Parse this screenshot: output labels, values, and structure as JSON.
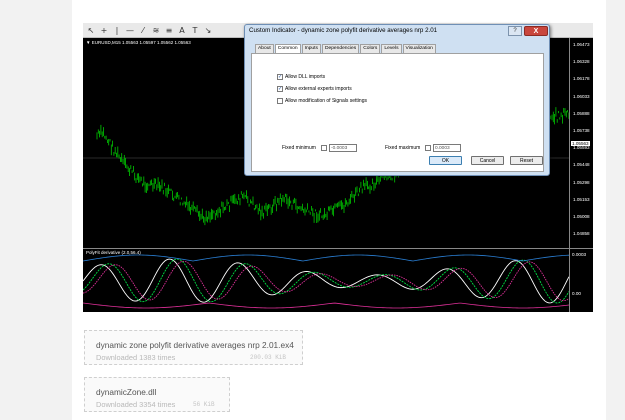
{
  "toolbar": {
    "icons": [
      "cursor-icon",
      "crosshair-icon",
      "vertical-line-icon",
      "horizontal-line-icon",
      "trendline-icon",
      "fibonacci-icon",
      "channel-icon",
      "text-icon",
      "text-label-icon",
      "arrows-icon"
    ],
    "glyphs": [
      "↖",
      "+",
      "|",
      "—",
      "⁄",
      "≋",
      "≡",
      "A",
      "T",
      "↘"
    ]
  },
  "chart": {
    "symbol_info": "▼ EURUSD,M15  1.05563 1.05597 1.05562 1.05563",
    "price_labels": [
      "1.06473",
      "1.06328",
      "1.06178",
      "1.06033",
      "1.05888",
      "1.05738",
      "1.05593",
      "1.05448",
      "1.05298",
      "1.05153",
      "1.05008",
      "1.04858"
    ],
    "current_price": "1.05563",
    "colors": {
      "background": "#000000",
      "candles": "#00c800",
      "sub_blue": "#2a7fd4",
      "sub_magenta": "#e0309a",
      "sub_green": "#00dd44",
      "sub_white": "#ffffff"
    }
  },
  "subchart": {
    "label": "PolyFit derivative (2.0,56.4)",
    "axis_top": "0.0003",
    "axis_mid": "0.00"
  },
  "dialog": {
    "title": "Custom Indicator - dynamic zone polyfit derivative averages nrp 2.01",
    "help_label": "?",
    "close_label": "X",
    "tabs": [
      "About",
      "Common",
      "Inputs",
      "Dependencies",
      "Colors",
      "Levels",
      "Visualization"
    ],
    "active_tab": "Common",
    "checkboxes": [
      {
        "label": "Allow DLL imports",
        "checked": true
      },
      {
        "label": "Allow external experts imports",
        "checked": true
      },
      {
        "label": "Allow modification of Signals settings",
        "checked": false
      }
    ],
    "fixed_min_label": "Fixed minimum",
    "fixed_min_value": "-0.0003",
    "fixed_max_label": "Fixed maximum",
    "fixed_max_value": "0.0003",
    "ok_label": "OK",
    "cancel_label": "Cancel",
    "reset_label": "Reset"
  },
  "downloads": [
    {
      "name": "dynamic zone polyfit derivative averages nrp 2.01.ex4",
      "count": "Downloaded 1383 times",
      "size": "200.03 KiB"
    },
    {
      "name": "dynamicZone.dll",
      "count": "Downloaded 3354 times",
      "size": "56 KiB"
    }
  ]
}
